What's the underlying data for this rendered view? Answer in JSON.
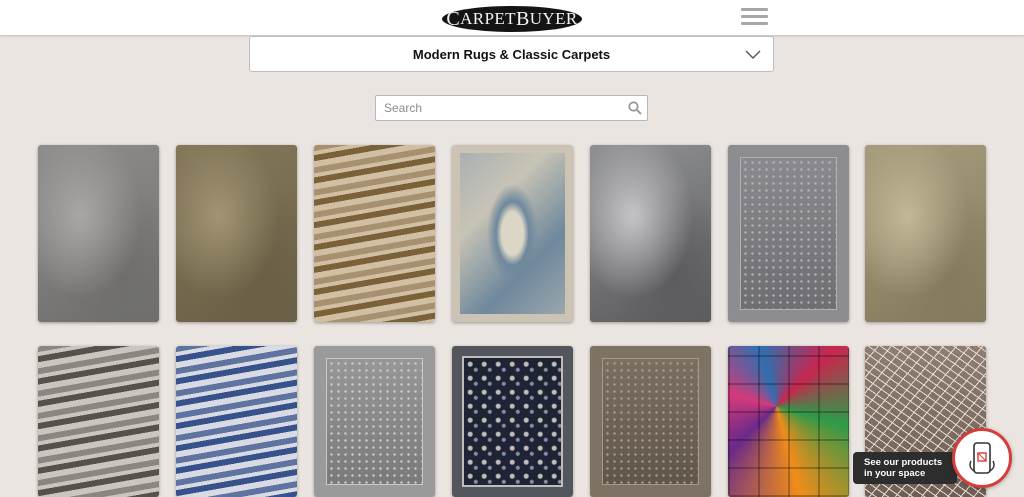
{
  "header": {
    "logo": {
      "first_cap": "C",
      "first_rest": "ARPET",
      "second_cap": "B",
      "second_rest": "UYER"
    },
    "menu_icon": "hamburger-menu-icon"
  },
  "category": {
    "selected": "Modern Rugs & Classic Carpets",
    "icon": "chevron-down-icon"
  },
  "search": {
    "placeholder": "Search",
    "value": "",
    "icon": "search-icon"
  },
  "products": [
    {
      "name": "grey-abstract-rug",
      "colors": [
        "#8e8d8b",
        "#a8a7a5",
        "#6f6e6c"
      ]
    },
    {
      "name": "olive-plain-rug",
      "colors": [
        "#84775a",
        "#a19473",
        "#6b5f45"
      ]
    },
    {
      "name": "gold-distressed-rug",
      "colors": [
        "#a69070",
        "#d0bfa2",
        "#7b6138"
      ]
    },
    {
      "name": "blue-medallion-rug",
      "colors": [
        "#a4acb0",
        "#c8c3b6",
        "#6e889c"
      ]
    },
    {
      "name": "silver-abstract-rug",
      "colors": [
        "#8f9093",
        "#c4c4c6",
        "#5c5c5e"
      ]
    },
    {
      "name": "grey-vintage-rug",
      "colors": [
        "#8c8c91",
        "#b0afb3",
        "#6c6b70"
      ]
    },
    {
      "name": "beige-floral-rug",
      "colors": [
        "#a69b7c",
        "#c2b797",
        "#867a5d"
      ]
    },
    {
      "name": "stone-stripe-rug",
      "colors": [
        "#8a8782",
        "#cac6bf",
        "#55524c"
      ]
    },
    {
      "name": "blue-white-abstract-rug",
      "colors": [
        "#5f73a0",
        "#d8dbe4",
        "#37528a"
      ]
    },
    {
      "name": "light-grey-border-rug",
      "colors": [
        "#9a9a9a",
        "#c9c9c9",
        "#777"
      ]
    },
    {
      "name": "navy-floral-rug",
      "colors": [
        "#1e2336",
        "#bfbdb5",
        "#54565e"
      ]
    },
    {
      "name": "taupe-border-rug",
      "colors": [
        "#7d7264",
        "#a59a8a",
        "#5d5347"
      ]
    },
    {
      "name": "patchwork-color-rug",
      "colors": [
        "#c8264f",
        "#2e9a4a",
        "#f08c1a"
      ]
    },
    {
      "name": "scribble-lines-rug",
      "colors": [
        "#8e7d72",
        "#e7ddd2",
        "#6e5e55"
      ]
    }
  ],
  "ar_prompt": {
    "line1": "See our products",
    "line2": "in your space",
    "icon": "phone-ar-icon",
    "accent": "#d93a3a"
  }
}
